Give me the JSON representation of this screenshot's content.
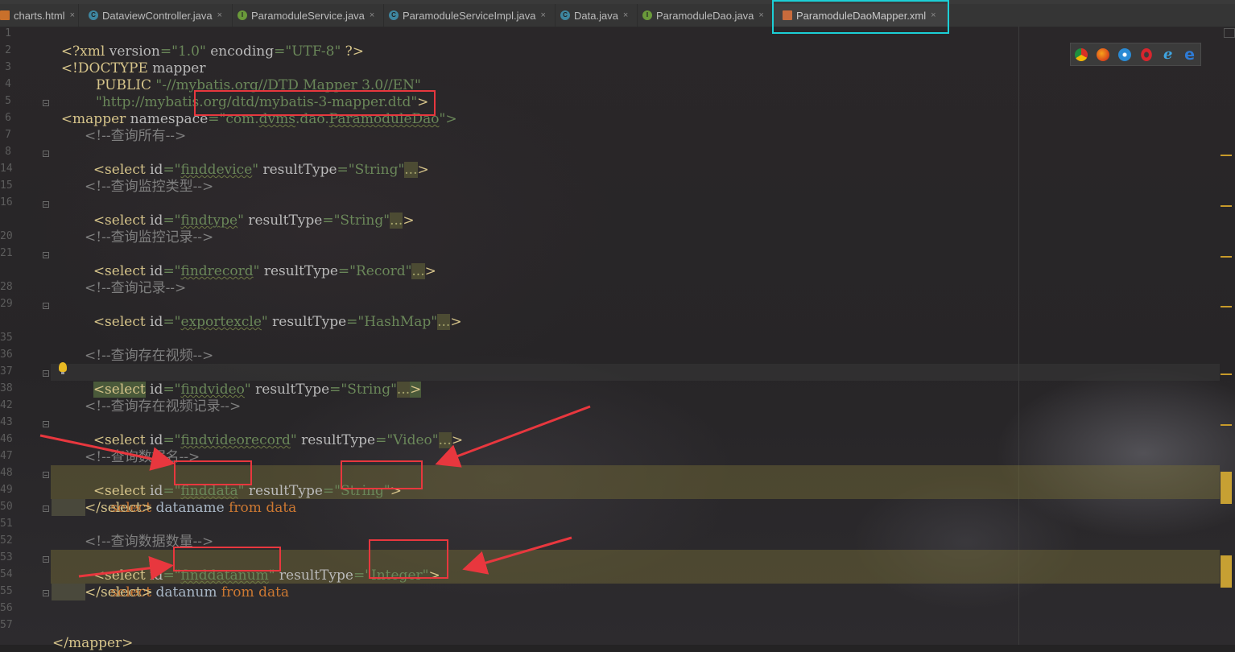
{
  "tabs": [
    {
      "label": "charts.html",
      "icon": "html-file-icon"
    },
    {
      "label": "DataviewController.java",
      "icon": "java-class-icon"
    },
    {
      "label": "ParamoduleService.java",
      "icon": "java-interface-icon"
    },
    {
      "label": "ParamoduleServiceImpl.java",
      "icon": "java-class-icon"
    },
    {
      "label": "Data.java",
      "icon": "java-class-icon"
    },
    {
      "label": "ParamoduleDao.java",
      "icon": "java-interface-icon"
    },
    {
      "label": "ParamoduleDaoMapper.xml",
      "icon": "xml-file-icon",
      "active": true
    }
  ],
  "tab_close_glyph": "×",
  "gutter": {
    "line_numbers": [
      "1",
      "2",
      "3",
      "4",
      "5",
      "6",
      "7",
      "8",
      "14",
      "15",
      "16",
      "20",
      "21",
      "28",
      "29",
      "35",
      "36",
      "37",
      "38",
      "42",
      "43",
      "46",
      "47",
      "48",
      "49",
      "50",
      "51",
      "52",
      "53",
      "54",
      "55",
      "56",
      "57"
    ]
  },
  "code": {
    "l1": {
      "a": "<?xml ",
      "b": "version",
      "c": "=\"1.0\" ",
      "d": "encoding",
      "e": "=\"UTF-8\" ",
      "f": "?>"
    },
    "l2": {
      "a": "<!DOCTYPE ",
      "b": "mapper"
    },
    "l3": {
      "a": "        PUBLIC ",
      "b": "\"-//mybatis.org//DTD Mapper 3.0//EN\""
    },
    "l4": {
      "a": "        \"http://mybatis.org/dtd/mybatis-3-mapper.dtd\"",
      "b": ">"
    },
    "l5": {
      "a": "<mapper ",
      "b": "namespace",
      "c": "=\"",
      "d": "com",
      "e": ".",
      "f": "dvms",
      "g": ".dao.",
      "h": "ParamoduleDao",
      "i": "\">"
    },
    "c1": "<!--查询所有-->",
    "s1": {
      "a": "<select ",
      "b": "id",
      "c": "=\"",
      "d": "finddevice",
      "e": "\" ",
      "f": "resultType",
      "g": "=\"String\"",
      "h": "...",
      "i": ">"
    },
    "c2": "<!--查询监控类型-->",
    "s2": {
      "a": "<select ",
      "b": "id",
      "c": "=\"",
      "d": "findtype",
      "e": "\" ",
      "f": "resultType",
      "g": "=\"String\"",
      "h": "...",
      "i": ">"
    },
    "c3": "<!--查询监控记录-->",
    "s3": {
      "a": "<select ",
      "b": "id",
      "c": "=\"",
      "d": "findrecord",
      "e": "\" ",
      "f": "resultType",
      "g": "=\"Record\"",
      "h": "...",
      "i": ">"
    },
    "c4": "<!--查询记录-->",
    "s4": {
      "a": "<select ",
      "b": "id",
      "c": "=\"",
      "d": "exportexcle",
      "e": "\" ",
      "f": "resultType",
      "g": "=\"HashMap\"",
      "h": "...",
      "i": ">"
    },
    "c5": "<!--查询存在视频-->",
    "s5": {
      "a": "<select",
      "b": " id",
      "c": "=\"",
      "d": "findvideo",
      "e": "\" ",
      "f": "resultType",
      "g": "=\"String\"",
      "h": "...",
      "i": ">"
    },
    "c6": "<!--查询存在视频记录-->",
    "s6": {
      "a": "<select ",
      "b": "id",
      "c": "=\"",
      "d": "findvideorecord",
      "e": "\" ",
      "f": "resultType",
      "g": "=\"Video\"",
      "h": "...",
      "i": ">"
    },
    "c7": "<!--查询数据名-->",
    "s7": {
      "a": "<select ",
      "b": "id",
      "c": "=\"",
      "d": "finddata",
      "e": "\" ",
      "f": "resultType",
      "g": "=\"String\"",
      "h": ">"
    },
    "q7": {
      "a": "    select ",
      "b": "dataname ",
      "c": "from ",
      "d": "data"
    },
    "e7": "</select>",
    "c8": "<!--查询数据数量-->",
    "s8": {
      "a": "<select ",
      "b": "id",
      "c": "=\"",
      "d": "finddatanum",
      "e": "\" ",
      "f": "resultType",
      "g": "=\"Integer\"",
      "h": ">"
    },
    "q8": {
      "a": "    select ",
      "b": "datanum ",
      "c": "from ",
      "d": "data"
    },
    "e8": "</select>",
    "end": "</mapper>"
  },
  "colors": {
    "annotation_red": "#e8373e",
    "active_tab_highlight": "#1ccfd6",
    "string_green": "#6a8759",
    "keyword_orange": "#cc7832",
    "tag_yellow": "#d6c48a"
  },
  "browser_icons": [
    "chrome-icon",
    "firefox-icon",
    "safari-icon",
    "opera-icon",
    "ie-icon",
    "edge-icon"
  ]
}
